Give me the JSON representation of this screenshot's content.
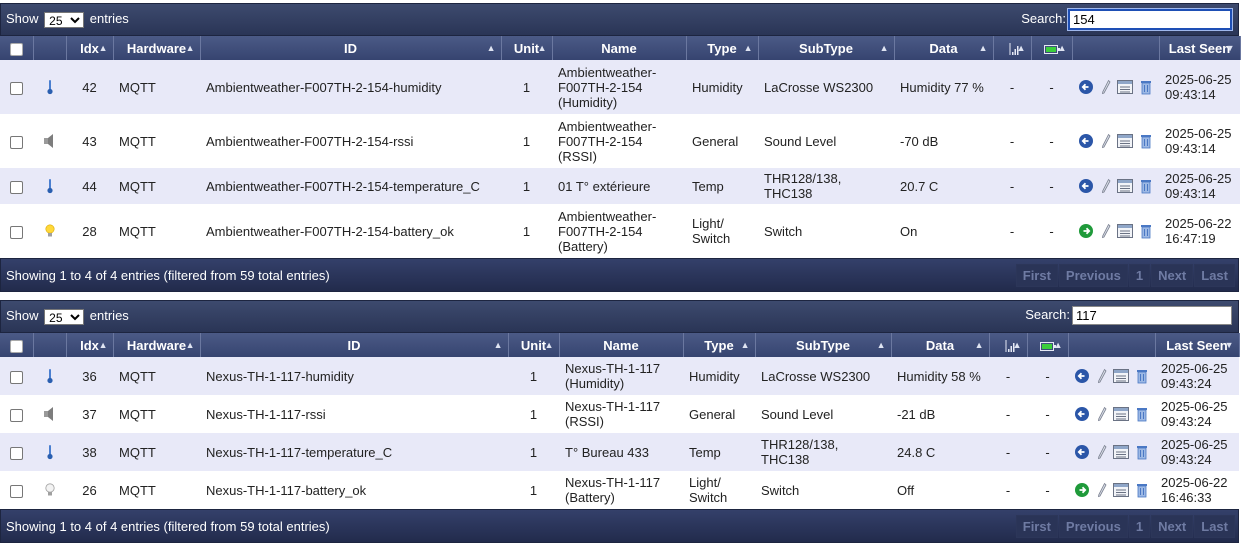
{
  "panels": [
    {
      "show_label": "Show",
      "page_size": "25",
      "entries_label": "entries",
      "search_label": "Search:",
      "search_value": "154",
      "columns": {
        "idx": "Idx",
        "hardware": "Hardware",
        "id": "ID",
        "unit": "Unit",
        "name": "Name",
        "type": "Type",
        "subtype": "SubType",
        "data": "Data",
        "last_seen": "Last Seen"
      },
      "rows": [
        {
          "icon": "thermometer-icon",
          "idx": "42",
          "hardware": "MQTT",
          "id": "Ambientweather-F007TH-2-154-humidity",
          "unit": "1",
          "name": "Ambientweather-F007TH-2-154 (Humidity)",
          "type": "Humidity",
          "subtype": "LaCrosse WS2300",
          "data": "Humidity 77 %",
          "signal": "-",
          "battery": "-",
          "last_seen": "2025-06-25 09:43:14"
        },
        {
          "icon": "speaker-icon",
          "idx": "43",
          "hardware": "MQTT",
          "id": "Ambientweather-F007TH-2-154-rssi",
          "unit": "1",
          "name": "Ambientweather-F007TH-2-154 (RSSI)",
          "type": "General",
          "subtype": "Sound Level",
          "data": "-70 dB",
          "signal": "-",
          "battery": "-",
          "last_seen": "2025-06-25 09:43:14"
        },
        {
          "icon": "thermometer-icon",
          "idx": "44",
          "hardware": "MQTT",
          "id": "Ambientweather-F007TH-2-154-temperature_C",
          "unit": "1",
          "name": "01 T° extérieure",
          "type": "Temp",
          "subtype": "THR128/138, THC138",
          "data": "20.7 C",
          "signal": "-",
          "battery": "-",
          "last_seen": "2025-06-25 09:43:14"
        },
        {
          "icon": "bulb-on-icon",
          "idx": "28",
          "hardware": "MQTT",
          "id": "Ambientweather-F007TH-2-154-battery_ok",
          "unit": "1",
          "name": "Ambientweather-F007TH-2-154 (Battery)",
          "type": "Light/ Switch",
          "subtype": "Switch",
          "data": "On",
          "signal": "-",
          "battery": "-",
          "last_seen": "2025-06-22 16:47:19"
        }
      ],
      "footer_info": "Showing 1 to 4 of 4 entries (filtered from 59 total entries)",
      "pager": {
        "first": "First",
        "previous": "Previous",
        "page": "1",
        "next": "Next",
        "last": "Last"
      }
    },
    {
      "show_label": "Show",
      "page_size": "25",
      "entries_label": "entries",
      "search_label": "Search:",
      "search_value": "117",
      "columns": {
        "idx": "Idx",
        "hardware": "Hardware",
        "id": "ID",
        "unit": "Unit",
        "name": "Name",
        "type": "Type",
        "subtype": "SubType",
        "data": "Data",
        "last_seen": "Last Seen"
      },
      "rows": [
        {
          "icon": "thermometer-icon",
          "idx": "36",
          "hardware": "MQTT",
          "id": "Nexus-TH-1-117-humidity",
          "unit": "1",
          "name": "Nexus-TH-1-117 (Humidity)",
          "type": "Humidity",
          "subtype": "LaCrosse WS2300",
          "data": "Humidity 58 %",
          "signal": "-",
          "battery": "-",
          "last_seen": "2025-06-25 09:43:24"
        },
        {
          "icon": "speaker-icon",
          "idx": "37",
          "hardware": "MQTT",
          "id": "Nexus-TH-1-117-rssi",
          "unit": "1",
          "name": "Nexus-TH-1-117 (RSSI)",
          "type": "General",
          "subtype": "Sound Level",
          "data": "-21 dB",
          "signal": "-",
          "battery": "-",
          "last_seen": "2025-06-25 09:43:24"
        },
        {
          "icon": "thermometer-icon",
          "idx": "38",
          "hardware": "MQTT",
          "id": "Nexus-TH-1-117-temperature_C",
          "unit": "1",
          "name": "T° Bureau 433",
          "type": "Temp",
          "subtype": "THR128/138, THC138",
          "data": "24.8 C",
          "signal": "-",
          "battery": "-",
          "last_seen": "2025-06-25 09:43:24"
        },
        {
          "icon": "bulb-off-icon",
          "idx": "26",
          "hardware": "MQTT",
          "id": "Nexus-TH-1-117-battery_ok",
          "unit": "1",
          "name": "Nexus-TH-1-117 (Battery)",
          "type": "Light/ Switch",
          "subtype": "Switch",
          "data": "Off",
          "signal": "-",
          "battery": "-",
          "last_seen": "2025-06-22 16:46:33"
        }
      ],
      "footer_info": "Showing 1 to 4 of 4 entries (filtered from 59 total entries)",
      "pager": {
        "first": "First",
        "previous": "Previous",
        "page": "1",
        "next": "Next",
        "last": "Last"
      }
    }
  ]
}
